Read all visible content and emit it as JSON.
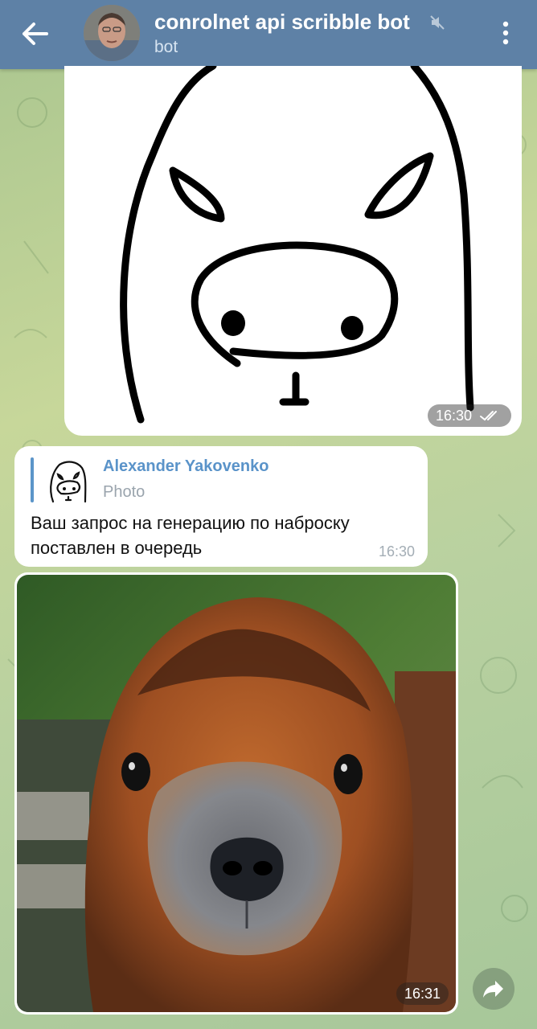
{
  "header": {
    "title": "conrolnet api scribble bot",
    "subtitle": "bot",
    "back_icon": "arrow-left-icon",
    "mute_icon": "muted-speaker-icon",
    "menu_icon": "kebab-menu-icon",
    "color": "#5e81a6"
  },
  "messages": {
    "sketch": {
      "time": "16:30",
      "status_icon": "double-check-icon"
    },
    "reply": {
      "quoted_name": "Alexander Yakovenko",
      "quoted_type": "Photo",
      "text": "Ваш запрос на генерацию по наброску поставлен в очередь",
      "time": "16:30"
    },
    "photo": {
      "time": "16:31",
      "share_icon": "share-forward-icon"
    }
  }
}
